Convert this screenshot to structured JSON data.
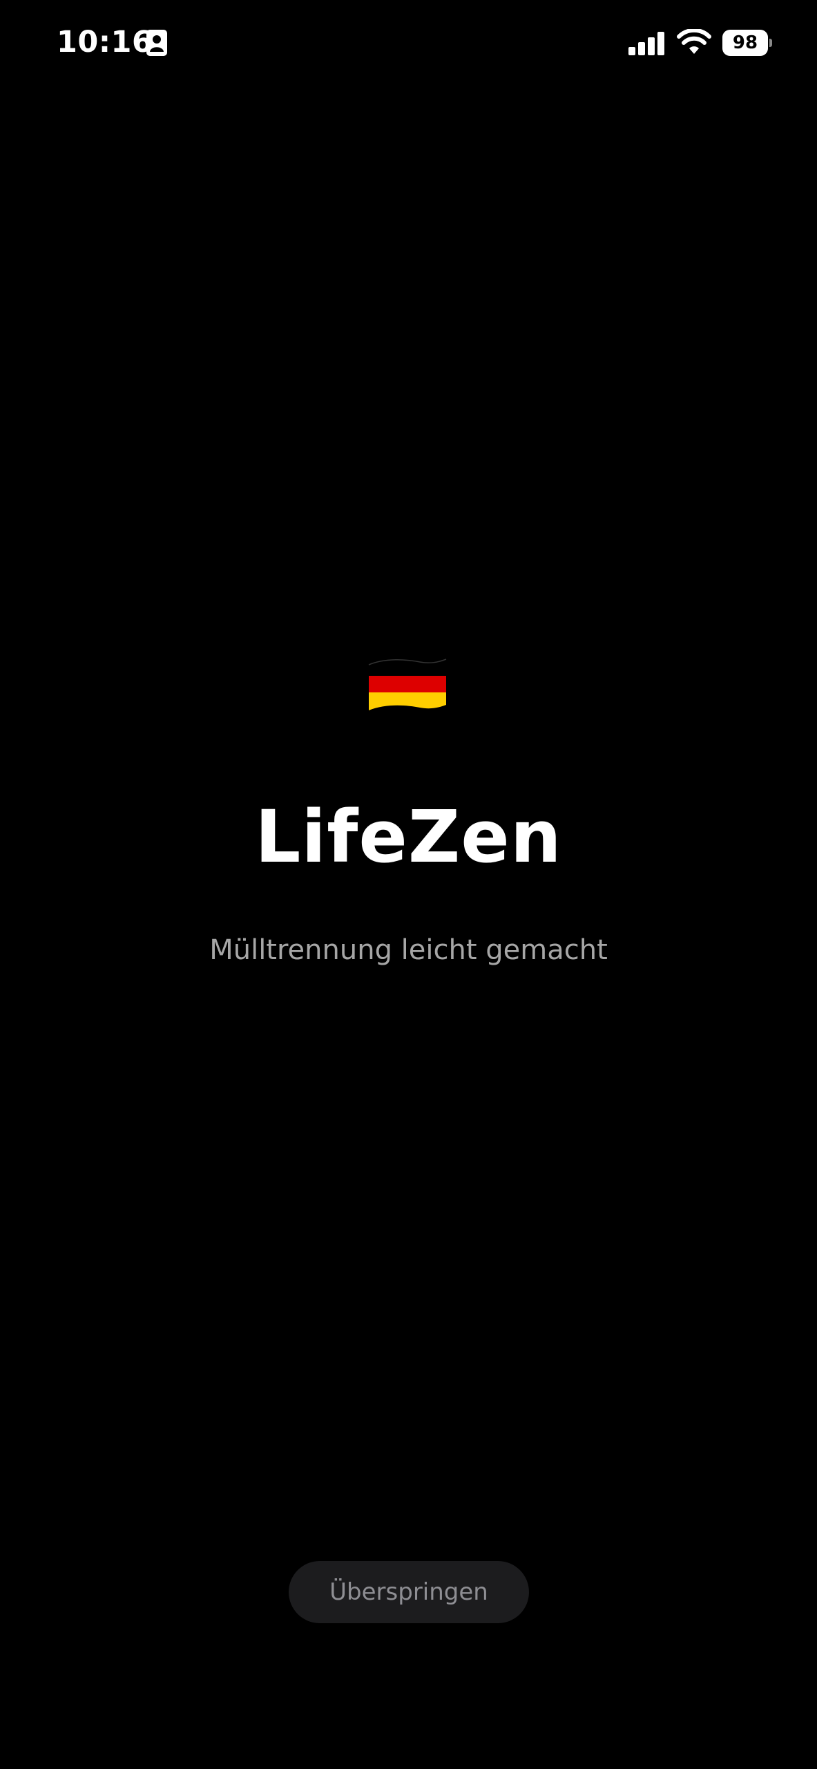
{
  "status_bar": {
    "time": "10:16",
    "battery_level": "98",
    "icons": [
      "contact-card-icon",
      "cellular-signal-icon",
      "wifi-icon",
      "battery-icon"
    ]
  },
  "splash": {
    "flag_icon": "germany-flag-icon",
    "title": "LifeZen",
    "subtitle": "Mülltrennung leicht gemacht"
  },
  "actions": {
    "skip_label": "Überspringen"
  },
  "colors": {
    "background": "#000000",
    "title": "#ffffff",
    "subtitle": "#a6a6a6",
    "skip_button_bg": "#1c1c1e",
    "skip_button_text": "#8e8e93",
    "flag_black": "#000000",
    "flag_red": "#dd0000",
    "flag_gold": "#ffce00"
  }
}
